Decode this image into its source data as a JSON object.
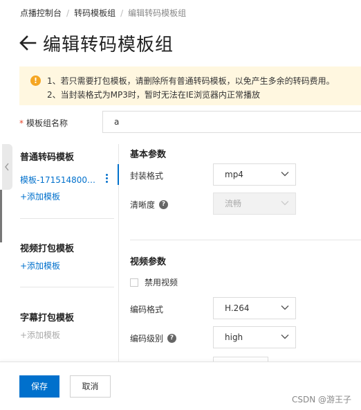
{
  "breadcrumb": {
    "items": [
      "点播控制台",
      "转码模板组",
      "编辑转码模板组"
    ],
    "separator": "/"
  },
  "header": {
    "title": "编辑转码模板组"
  },
  "notice": {
    "icon": "warning-icon",
    "line1": "1、若只需要打包模板，请删除所有普通转码模板，以免产生多余的转码费用。",
    "line2": "2、当封装格式为MP3时，暂时无法在IE浏览器内正常播放"
  },
  "name_field": {
    "required_mark": "*",
    "label": "模板组名称",
    "value": "a"
  },
  "left_panel": {
    "normal": {
      "title": "普通转码模板",
      "item": "模板-17151480039...",
      "add": "+添加模板"
    },
    "video_pack": {
      "title": "视频打包模板",
      "add": "+添加模板"
    },
    "subtitle_pack": {
      "title": "字幕打包模板",
      "add": "+添加模板"
    }
  },
  "basic_params": {
    "title": "基本参数",
    "format_label": "封装格式",
    "format_value": "mp4",
    "clarity_label": "清晰度",
    "clarity_value": "流畅",
    "help_icon": "question-icon"
  },
  "video_params": {
    "title": "视频参数",
    "disable_video_label": "禁用视频",
    "codec_label": "编码格式",
    "codec_value": "H.264",
    "profile_label": "编码级别",
    "profile_value": "high"
  },
  "footer": {
    "save": "保存",
    "cancel": "取消",
    "watermark": "CSDN @游王子"
  },
  "colors": {
    "primary": "#0070cc",
    "notice_bg": "#fff7e0",
    "warning": "#f5a623",
    "required": "#e5462b"
  }
}
